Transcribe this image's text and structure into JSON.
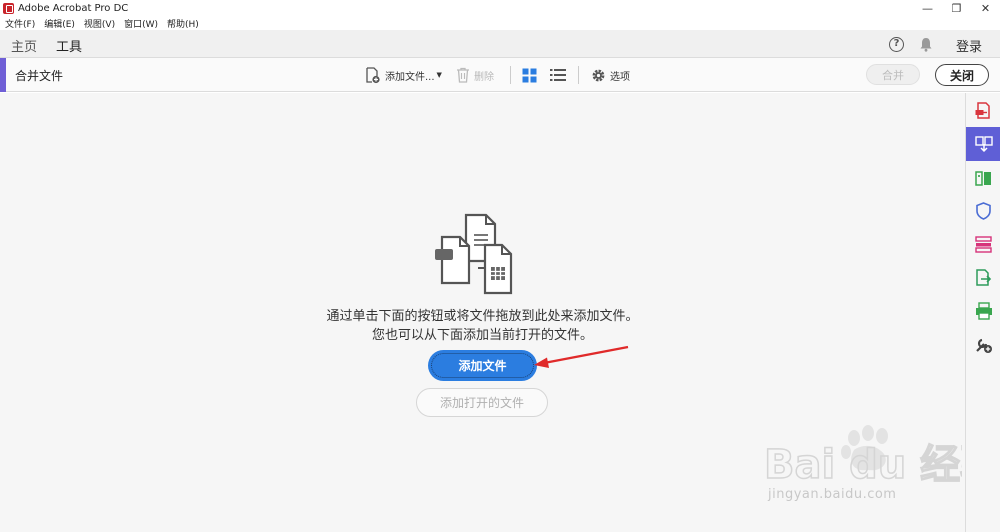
{
  "window": {
    "title": "Adobe Acrobat Pro DC",
    "controls": [
      "—",
      "❐",
      "✕"
    ]
  },
  "menu": [
    {
      "label": "文件(F)"
    },
    {
      "label": "编辑(E)"
    },
    {
      "label": "视图(V)"
    },
    {
      "label": "窗口(W)"
    },
    {
      "label": "帮助(H)"
    }
  ],
  "nav": {
    "tabs": [
      {
        "label": "主页",
        "active": false
      },
      {
        "label": "工具",
        "active": true
      }
    ],
    "help_icon": "?",
    "login": "登录"
  },
  "toolbar": {
    "title": "合并文件",
    "add_files": "添加文件...",
    "delete": "删除",
    "options": "选项",
    "merge": "合并",
    "close": "关闭",
    "accent_color": "#6f5fd6"
  },
  "main": {
    "line1": "通过单击下面的按钮或将文件拖放到此处来添加文件。",
    "line2": "您也可以从下面添加当前打开的文件。",
    "add_files_button": "添加文件",
    "add_open_files_button": "添加打开的文件",
    "primary_color": "#2b7de0"
  },
  "rail": {
    "items": [
      {
        "name": "create-pdf-icon",
        "color": "#d9363e",
        "active": false
      },
      {
        "name": "combine-files-icon",
        "color": "#ffffff",
        "active": true
      },
      {
        "name": "organize-pages-icon",
        "color": "#3aa64f",
        "active": false
      },
      {
        "name": "protect-icon",
        "color": "#4a6cd4",
        "active": false
      },
      {
        "name": "prepare-form-icon",
        "color": "#d6337a",
        "active": false
      },
      {
        "name": "export-pdf-icon",
        "color": "#2e9c5b",
        "active": false
      },
      {
        "name": "print-production-icon",
        "color": "#3aa64f",
        "active": false
      },
      {
        "name": "more-tools-icon",
        "color": "#444444",
        "active": false
      }
    ],
    "active_color": "#5f5fd6"
  },
  "watermark": {
    "brand": "Bai du 经验",
    "url": "jingyan.baidu.com"
  }
}
